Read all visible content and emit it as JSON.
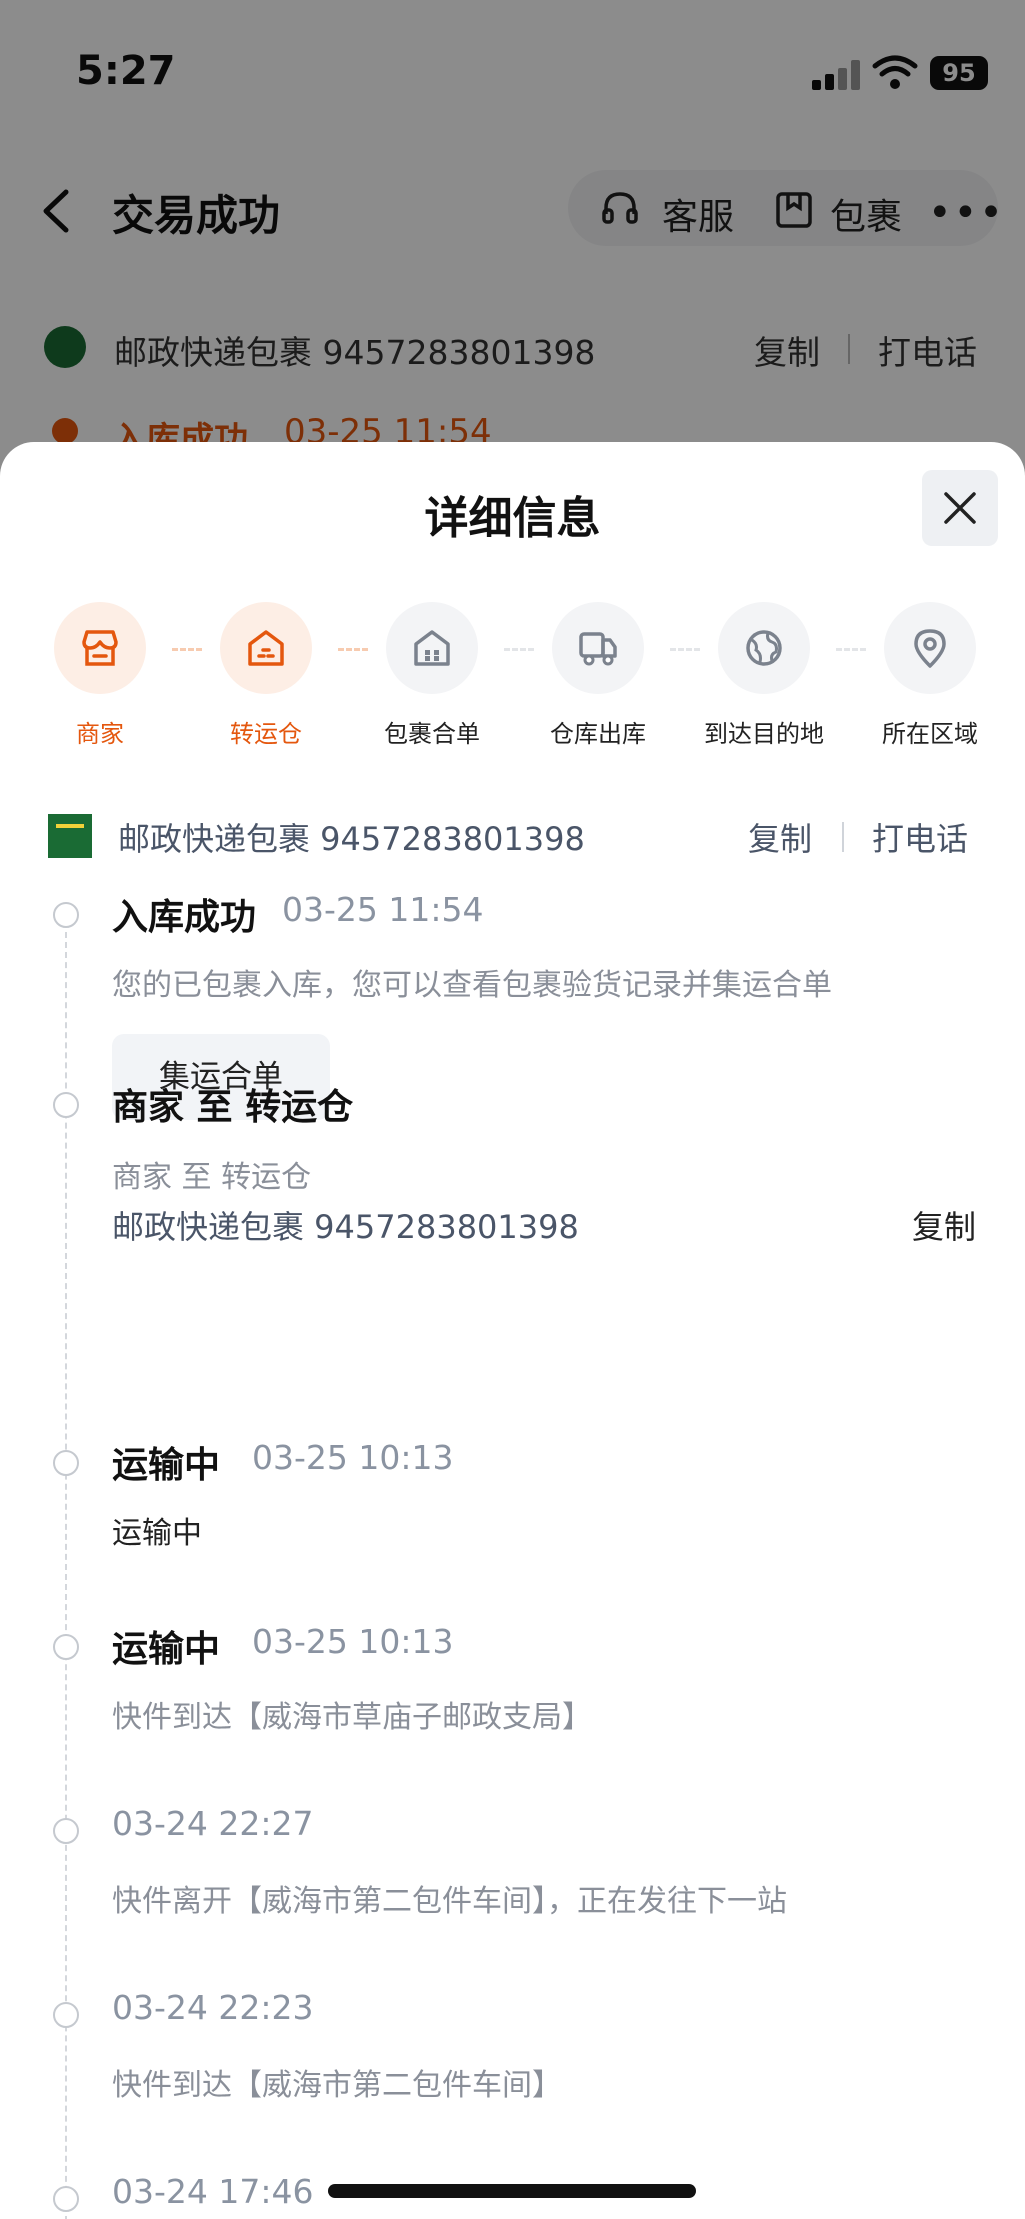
{
  "status_bar": {
    "time": "5:27",
    "battery": "95"
  },
  "nav": {
    "title": "交易成功",
    "service_label": "客服",
    "package_label": "包裹",
    "more_label": "•••"
  },
  "background_tracking": {
    "carrier_text": "邮政快递包裹 9457283801398",
    "copy_label": "复制",
    "call_label": "打电话",
    "status": "入库成功",
    "status_time": "03-25 11:54"
  },
  "sheet": {
    "title": "详细信息",
    "steps": [
      {
        "label": "商家",
        "icon": "store-icon",
        "active": true
      },
      {
        "label": "转运仓",
        "icon": "warehouse-icon",
        "active": true
      },
      {
        "label": "包裹合单",
        "icon": "package-merge-icon",
        "active": false
      },
      {
        "label": "仓库出库",
        "icon": "truck-icon",
        "active": false
      },
      {
        "label": "到达目的地",
        "icon": "globe-icon",
        "active": false
      },
      {
        "label": "所在区域",
        "icon": "location-pin-icon",
        "active": false
      }
    ],
    "tracking": {
      "carrier_text": "邮政快递包裹 9457283801398",
      "copy_label": "复制",
      "call_label": "打电话"
    },
    "timeline": [
      {
        "title": "入库成功",
        "time": "03-25 11:54",
        "desc": "您的已包裹入库，您可以查看包裹验货记录并集运合单",
        "button": "集运合单"
      },
      {
        "title": "商家 至 转运仓",
        "desc": "商家 至 转运仓",
        "track": "邮政快递包裹 9457283801398",
        "copy": "复制"
      },
      {
        "title": "运输中",
        "time": "03-25 10:13",
        "desc": "运输中"
      },
      {
        "title": "运输中",
        "time": "03-25 10:13",
        "desc": "快件到达【威海市草庙子邮政支局】"
      },
      {
        "time": "03-24 22:27",
        "desc": "快件离开【威海市第二包件车间】，正在发往下一站"
      },
      {
        "time": "03-24 22:23",
        "desc": "快件到达【威海市第二包件车间】"
      },
      {
        "time": "03-24 17:46"
      }
    ]
  },
  "colors": {
    "accent": "#e4570e",
    "accent_light": "#fdeee5",
    "postal_green": "#1a6b34"
  }
}
